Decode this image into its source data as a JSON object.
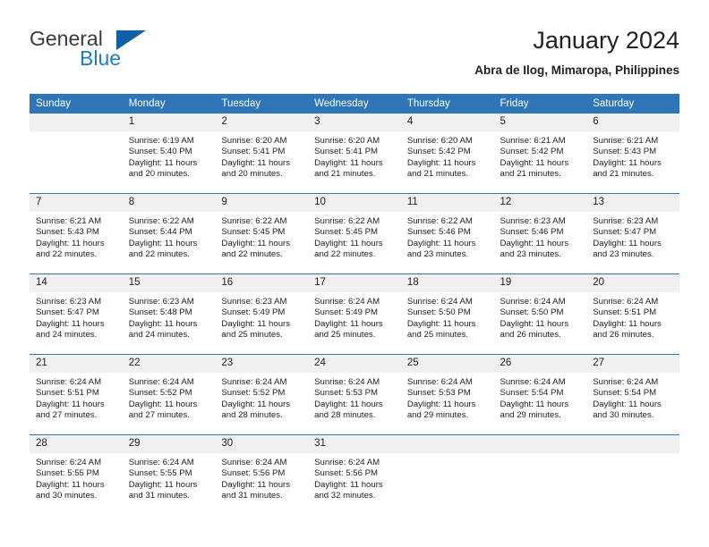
{
  "brand": {
    "name_part1": "General",
    "name_part2": "Blue",
    "triangle_icon": "triangle-icon",
    "accent_blue": "#1d7cc4",
    "dark_blue": "#0f5fa6"
  },
  "header": {
    "title": "January 2024",
    "subtitle": "Abra de Ilog, Mimaropa, Philippines"
  },
  "theme": {
    "header_bg": "#2e76b8",
    "daynum_bg": "#f0f0f0",
    "text": "#222222"
  },
  "weekdays": [
    "Sunday",
    "Monday",
    "Tuesday",
    "Wednesday",
    "Thursday",
    "Friday",
    "Saturday"
  ],
  "weeks": [
    [
      {
        "day": "",
        "empty": true,
        "sunrise": "",
        "sunset": "",
        "daylight_line1": "",
        "daylight_line2": ""
      },
      {
        "day": "1",
        "empty": false,
        "sunrise": "Sunrise: 6:19 AM",
        "sunset": "Sunset: 5:40 PM",
        "daylight_line1": "Daylight: 11 hours",
        "daylight_line2": "and 20 minutes."
      },
      {
        "day": "2",
        "empty": false,
        "sunrise": "Sunrise: 6:20 AM",
        "sunset": "Sunset: 5:41 PM",
        "daylight_line1": "Daylight: 11 hours",
        "daylight_line2": "and 20 minutes."
      },
      {
        "day": "3",
        "empty": false,
        "sunrise": "Sunrise: 6:20 AM",
        "sunset": "Sunset: 5:41 PM",
        "daylight_line1": "Daylight: 11 hours",
        "daylight_line2": "and 21 minutes."
      },
      {
        "day": "4",
        "empty": false,
        "sunrise": "Sunrise: 6:20 AM",
        "sunset": "Sunset: 5:42 PM",
        "daylight_line1": "Daylight: 11 hours",
        "daylight_line2": "and 21 minutes."
      },
      {
        "day": "5",
        "empty": false,
        "sunrise": "Sunrise: 6:21 AM",
        "sunset": "Sunset: 5:42 PM",
        "daylight_line1": "Daylight: 11 hours",
        "daylight_line2": "and 21 minutes."
      },
      {
        "day": "6",
        "empty": false,
        "sunrise": "Sunrise: 6:21 AM",
        "sunset": "Sunset: 5:43 PM",
        "daylight_line1": "Daylight: 11 hours",
        "daylight_line2": "and 21 minutes."
      }
    ],
    [
      {
        "day": "7",
        "empty": false,
        "sunrise": "Sunrise: 6:21 AM",
        "sunset": "Sunset: 5:43 PM",
        "daylight_line1": "Daylight: 11 hours",
        "daylight_line2": "and 22 minutes."
      },
      {
        "day": "8",
        "empty": false,
        "sunrise": "Sunrise: 6:22 AM",
        "sunset": "Sunset: 5:44 PM",
        "daylight_line1": "Daylight: 11 hours",
        "daylight_line2": "and 22 minutes."
      },
      {
        "day": "9",
        "empty": false,
        "sunrise": "Sunrise: 6:22 AM",
        "sunset": "Sunset: 5:45 PM",
        "daylight_line1": "Daylight: 11 hours",
        "daylight_line2": "and 22 minutes."
      },
      {
        "day": "10",
        "empty": false,
        "sunrise": "Sunrise: 6:22 AM",
        "sunset": "Sunset: 5:45 PM",
        "daylight_line1": "Daylight: 11 hours",
        "daylight_line2": "and 22 minutes."
      },
      {
        "day": "11",
        "empty": false,
        "sunrise": "Sunrise: 6:22 AM",
        "sunset": "Sunset: 5:46 PM",
        "daylight_line1": "Daylight: 11 hours",
        "daylight_line2": "and 23 minutes."
      },
      {
        "day": "12",
        "empty": false,
        "sunrise": "Sunrise: 6:23 AM",
        "sunset": "Sunset: 5:46 PM",
        "daylight_line1": "Daylight: 11 hours",
        "daylight_line2": "and 23 minutes."
      },
      {
        "day": "13",
        "empty": false,
        "sunrise": "Sunrise: 6:23 AM",
        "sunset": "Sunset: 5:47 PM",
        "daylight_line1": "Daylight: 11 hours",
        "daylight_line2": "and 23 minutes."
      }
    ],
    [
      {
        "day": "14",
        "empty": false,
        "sunrise": "Sunrise: 6:23 AM",
        "sunset": "Sunset: 5:47 PM",
        "daylight_line1": "Daylight: 11 hours",
        "daylight_line2": "and 24 minutes."
      },
      {
        "day": "15",
        "empty": false,
        "sunrise": "Sunrise: 6:23 AM",
        "sunset": "Sunset: 5:48 PM",
        "daylight_line1": "Daylight: 11 hours",
        "daylight_line2": "and 24 minutes."
      },
      {
        "day": "16",
        "empty": false,
        "sunrise": "Sunrise: 6:23 AM",
        "sunset": "Sunset: 5:49 PM",
        "daylight_line1": "Daylight: 11 hours",
        "daylight_line2": "and 25 minutes."
      },
      {
        "day": "17",
        "empty": false,
        "sunrise": "Sunrise: 6:24 AM",
        "sunset": "Sunset: 5:49 PM",
        "daylight_line1": "Daylight: 11 hours",
        "daylight_line2": "and 25 minutes."
      },
      {
        "day": "18",
        "empty": false,
        "sunrise": "Sunrise: 6:24 AM",
        "sunset": "Sunset: 5:50 PM",
        "daylight_line1": "Daylight: 11 hours",
        "daylight_line2": "and 25 minutes."
      },
      {
        "day": "19",
        "empty": false,
        "sunrise": "Sunrise: 6:24 AM",
        "sunset": "Sunset: 5:50 PM",
        "daylight_line1": "Daylight: 11 hours",
        "daylight_line2": "and 26 minutes."
      },
      {
        "day": "20",
        "empty": false,
        "sunrise": "Sunrise: 6:24 AM",
        "sunset": "Sunset: 5:51 PM",
        "daylight_line1": "Daylight: 11 hours",
        "daylight_line2": "and 26 minutes."
      }
    ],
    [
      {
        "day": "21",
        "empty": false,
        "sunrise": "Sunrise: 6:24 AM",
        "sunset": "Sunset: 5:51 PM",
        "daylight_line1": "Daylight: 11 hours",
        "daylight_line2": "and 27 minutes."
      },
      {
        "day": "22",
        "empty": false,
        "sunrise": "Sunrise: 6:24 AM",
        "sunset": "Sunset: 5:52 PM",
        "daylight_line1": "Daylight: 11 hours",
        "daylight_line2": "and 27 minutes."
      },
      {
        "day": "23",
        "empty": false,
        "sunrise": "Sunrise: 6:24 AM",
        "sunset": "Sunset: 5:52 PM",
        "daylight_line1": "Daylight: 11 hours",
        "daylight_line2": "and 28 minutes."
      },
      {
        "day": "24",
        "empty": false,
        "sunrise": "Sunrise: 6:24 AM",
        "sunset": "Sunset: 5:53 PM",
        "daylight_line1": "Daylight: 11 hours",
        "daylight_line2": "and 28 minutes."
      },
      {
        "day": "25",
        "empty": false,
        "sunrise": "Sunrise: 6:24 AM",
        "sunset": "Sunset: 5:53 PM",
        "daylight_line1": "Daylight: 11 hours",
        "daylight_line2": "and 29 minutes."
      },
      {
        "day": "26",
        "empty": false,
        "sunrise": "Sunrise: 6:24 AM",
        "sunset": "Sunset: 5:54 PM",
        "daylight_line1": "Daylight: 11 hours",
        "daylight_line2": "and 29 minutes."
      },
      {
        "day": "27",
        "empty": false,
        "sunrise": "Sunrise: 6:24 AM",
        "sunset": "Sunset: 5:54 PM",
        "daylight_line1": "Daylight: 11 hours",
        "daylight_line2": "and 30 minutes."
      }
    ],
    [
      {
        "day": "28",
        "empty": false,
        "sunrise": "Sunrise: 6:24 AM",
        "sunset": "Sunset: 5:55 PM",
        "daylight_line1": "Daylight: 11 hours",
        "daylight_line2": "and 30 minutes."
      },
      {
        "day": "29",
        "empty": false,
        "sunrise": "Sunrise: 6:24 AM",
        "sunset": "Sunset: 5:55 PM",
        "daylight_line1": "Daylight: 11 hours",
        "daylight_line2": "and 31 minutes."
      },
      {
        "day": "30",
        "empty": false,
        "sunrise": "Sunrise: 6:24 AM",
        "sunset": "Sunset: 5:56 PM",
        "daylight_line1": "Daylight: 11 hours",
        "daylight_line2": "and 31 minutes."
      },
      {
        "day": "31",
        "empty": false,
        "sunrise": "Sunrise: 6:24 AM",
        "sunset": "Sunset: 5:56 PM",
        "daylight_line1": "Daylight: 11 hours",
        "daylight_line2": "and 32 minutes."
      },
      {
        "day": "",
        "empty": true,
        "sunrise": "",
        "sunset": "",
        "daylight_line1": "",
        "daylight_line2": ""
      },
      {
        "day": "",
        "empty": true,
        "sunrise": "",
        "sunset": "",
        "daylight_line1": "",
        "daylight_line2": ""
      },
      {
        "day": "",
        "empty": true,
        "sunrise": "",
        "sunset": "",
        "daylight_line1": "",
        "daylight_line2": ""
      }
    ]
  ]
}
